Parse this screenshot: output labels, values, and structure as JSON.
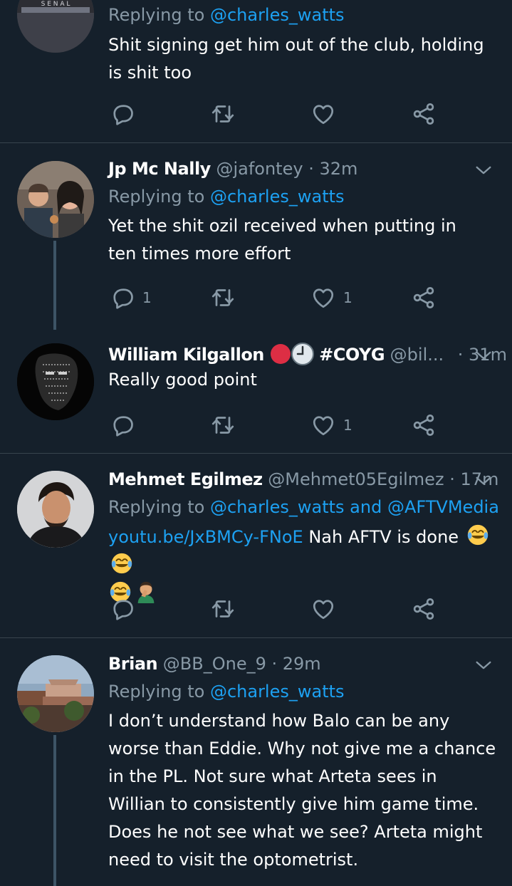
{
  "colors": {
    "background": "#15202b",
    "separator": "#38444d",
    "muted": "#8899a6",
    "link": "#1da1f2",
    "text": "#ffffff"
  },
  "tweet0": {
    "reply_prefix": "Replying to",
    "reply_handle": "@charles_watts",
    "text": "Shit signing get him out of the club, holding is shit too",
    "avatar_sign": "S E N A L"
  },
  "tweet1": {
    "name": "Jp Mc Nally",
    "handle": "@jafontey",
    "time": "· 32m",
    "reply_prefix": "Replying to",
    "reply_handle": "@charles_watts",
    "text": "Yet the shit ozil received when putting in ten times more effort",
    "reply_count": "1",
    "like_count": "1"
  },
  "tweet2": {
    "name": "William Kilgallon",
    "hashtag": "#COYG",
    "handle": "@bil...",
    "time": "· 31m",
    "text": "Really good point",
    "like_count": "1"
  },
  "tweet3": {
    "name": "Mehmet Egilmez",
    "handle": "@Mehmet05Egilmez",
    "time": "· 17m",
    "reply_prefix": "Replying to",
    "reply_handle1": "@charles_watts",
    "reply_and": "and",
    "reply_handle2": "@AFTVMedia",
    "link": "youtu.be/JxBMCy-FNoE",
    "text": "Nah AFTV is done"
  },
  "tweet4": {
    "name": "Brian",
    "handle": "@BB_One_9",
    "time": "· 29m",
    "reply_prefix": "Replying to",
    "reply_handle": "@charles_watts",
    "text": "I don’t understand how Balo can be any worse than Eddie. Why not give me a chance in the PL. Not sure what Arteta sees in Willian to consistently give him game time. Does he not see what we see? Arteta might need to visit the optometrist."
  },
  "icons": {
    "reply": "reply-icon",
    "retweet": "retweet-icon",
    "like": "heart-icon",
    "share": "share-icon",
    "more": "chevron-down-icon"
  }
}
